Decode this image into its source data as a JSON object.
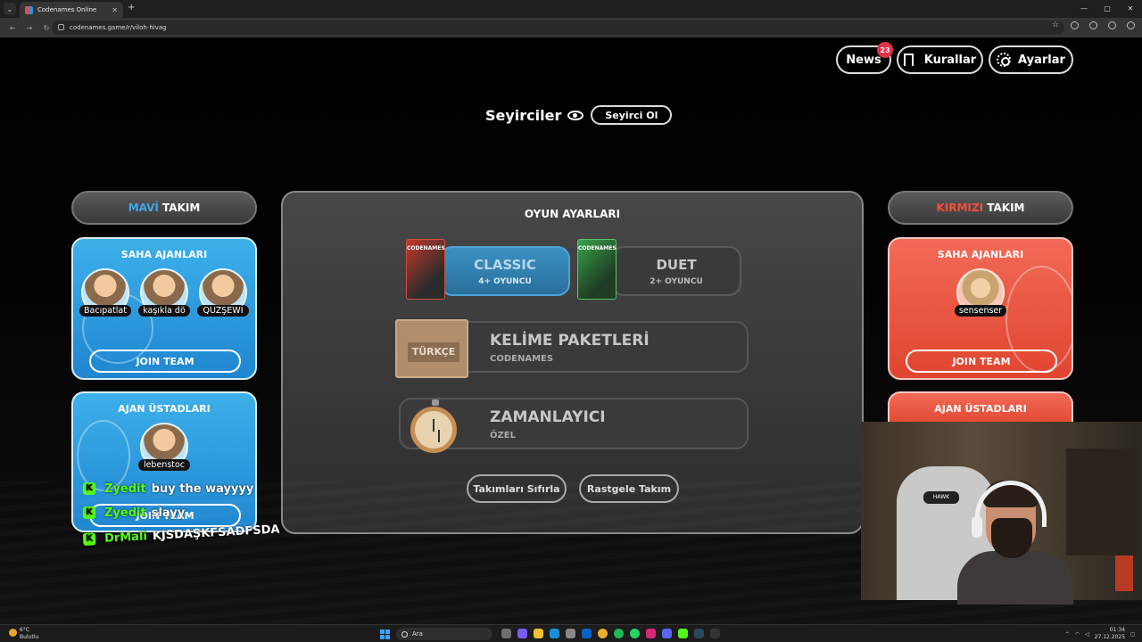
{
  "browser": {
    "tab_title": "Codenames Online",
    "tab_close": "✕",
    "new_tab": "+",
    "url": "codenames.game/r/viloh-hivag",
    "window_controls": [
      "—",
      "▢",
      "✕"
    ]
  },
  "header": {
    "news_label": "News",
    "news_badge": "23",
    "rules_label": "Kurallar",
    "settings_label": "Ayarlar"
  },
  "spectators": {
    "title": "Seyirciler",
    "button": "Seyirci Ol"
  },
  "blue_team": {
    "header_accent": "MAVİ",
    "header_rest": " TAKIM",
    "operatives_title": "SAHA AJANLARI",
    "operatives": [
      "Bacıpatlat",
      "kaşıkla dö",
      "QUZŞEWİ"
    ],
    "join_label": "JOIN TEAM",
    "spymasters_title": "AJAN ÜSTADLARI",
    "spymasters": [
      "lebenstoc"
    ],
    "spymaster_join_label": "JOIN TEAM"
  },
  "red_team": {
    "header_accent": "KIRMIZI",
    "header_rest": " TAKIM",
    "operatives_title": "SAHA AJANLARI",
    "operatives": [
      "sensenser"
    ],
    "join_label": "JOIN TEAM",
    "spymasters_title": "AJAN ÜSTADLARI"
  },
  "game_settings": {
    "title": "OYUN AYARLARI",
    "modes": [
      {
        "name": "CLASSIC",
        "players": "4+ OYUNCU",
        "selected": true,
        "box_label": "CODENAMES"
      },
      {
        "name": "DUET",
        "players": "2+ OYUNCU",
        "selected": false,
        "box_label": "CODENAMES"
      }
    ],
    "word_packs": {
      "title": "KELİME PAKETLERİ",
      "subtitle": "CODENAMES",
      "badge": "TÜRKÇE"
    },
    "timer": {
      "title": "ZAMANLAYICI",
      "subtitle": "ÖZEL"
    },
    "reset_button": "Takımları Sıfırla",
    "random_button": "Rastgele Takım"
  },
  "chat_overlay": [
    {
      "badge": "K",
      "user": "Zyedit",
      "message": "buy the wayyyy"
    },
    {
      "badge": "K",
      "user": "Zyedit",
      "message": "slayy"
    },
    {
      "badge": "K",
      "user": "DrMali",
      "message": "KJSDAŞKFSADFSDA"
    }
  ],
  "webcam": {
    "chair_brand": "HAWK"
  },
  "taskbar": {
    "temperature": "6°C",
    "weather": "Bulutlu",
    "search_placeholder": "Ara",
    "time": "01:34",
    "date": "27.12.2025"
  },
  "colors": {
    "blue_team": "#3ea8e8",
    "red_team": "#f0503a",
    "badge": "#e03048",
    "kick_green": "#53fc18"
  }
}
